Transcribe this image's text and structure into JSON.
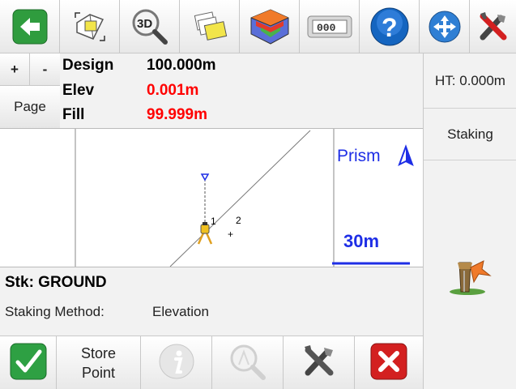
{
  "toolbar": {
    "buttons": [
      {
        "icon": "back-arrow-icon"
      },
      {
        "icon": "map-layout-icon"
      },
      {
        "icon": "3d-zoom-icon",
        "label": "3D"
      },
      {
        "icon": "layers-icon"
      },
      {
        "icon": "surface-icon"
      },
      {
        "icon": "counter-icon",
        "label": "000"
      },
      {
        "icon": "help-icon",
        "label": "?"
      },
      {
        "icon": "pan-icon"
      },
      {
        "icon": "tools-icon"
      }
    ]
  },
  "zoom": {
    "plus": "+",
    "minus": "-",
    "page": "Page"
  },
  "readout": {
    "design_label": "Design",
    "design_value": "100.000m",
    "elev_label": "Elev",
    "elev_value": "0.001m",
    "fill_label": "Fill",
    "fill_value": "99.999m"
  },
  "right_panel": {
    "ht": "HT: 0.000m",
    "mode": "Staking"
  },
  "map": {
    "target_label": "Prism",
    "scale_label": "30m",
    "point_1": "1",
    "point_2": "2"
  },
  "status": {
    "stake_label": "Stk: GROUND",
    "method_label": "Staking Method:",
    "method_value": "Elevation"
  },
  "bottom_bar": {
    "store_line1": "Store",
    "store_line2": "Point"
  },
  "colors": {
    "value_red": "#ff0000",
    "map_blue": "#1e2ee6",
    "accept_green": "#2ea043",
    "cancel_red": "#d32020"
  }
}
